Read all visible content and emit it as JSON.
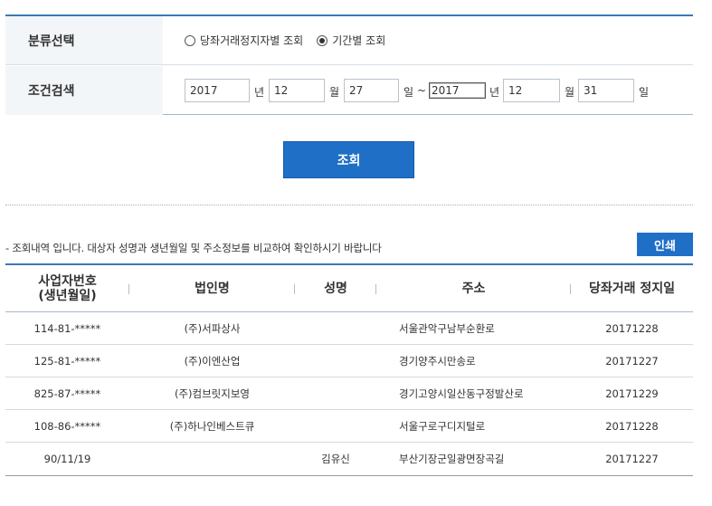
{
  "filter": {
    "category_label": "분류선택",
    "options": [
      {
        "label": "당좌거래정지자별 조회",
        "selected": false
      },
      {
        "label": "기간별 조회",
        "selected": true
      }
    ]
  },
  "condition": {
    "label": "조건검색",
    "from": {
      "year": "2017",
      "month": "12",
      "day": "27"
    },
    "to": {
      "year": "2017",
      "month": "12",
      "day": "31"
    },
    "unit_year": "년",
    "unit_month": "월",
    "unit_day": "일",
    "tilde": "~"
  },
  "search_button": "조회",
  "notice": "- 조회내역 입니다. 대상자 성명과 생년월일 및 주소정보를 비교하여 확인하시기 바랍니다",
  "print_button": "인쇄",
  "table": {
    "headers": [
      "사업자번호\n(생년월일)",
      "법인명",
      "성명",
      "주소",
      "당좌거래 정지일"
    ],
    "rows": [
      [
        "114-81-*****",
        "(주)서파상사",
        "",
        "서울관악구남부순환로",
        "20171228"
      ],
      [
        "125-81-*****",
        "(주)이엔산업",
        "",
        "경기양주시만송로",
        "20171227"
      ],
      [
        "825-87-*****",
        "(주)컴브릿지보영",
        "",
        "경기고양시일산동구정발산로",
        "20171229"
      ],
      [
        "108-86-*****",
        "(주)하나인베스트큐",
        "",
        "서울구로구디지털로",
        "20171228"
      ],
      [
        "90/11/19",
        "",
        "김유신",
        "부산기장군일광면장곡길",
        "20171227"
      ]
    ]
  }
}
